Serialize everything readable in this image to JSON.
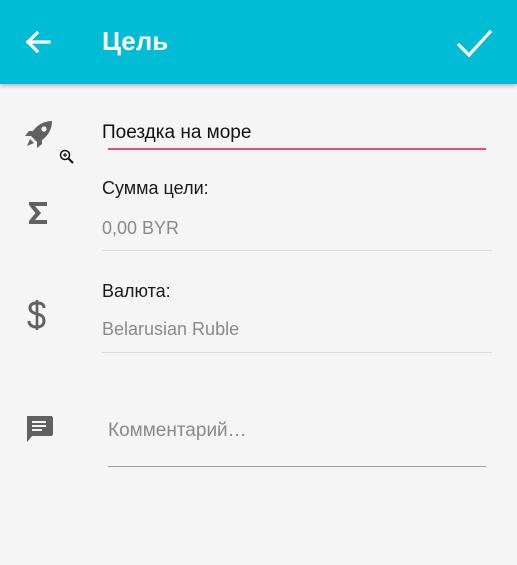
{
  "appbar": {
    "title": "Цель",
    "color": "#00bcd4",
    "back_icon": "arrow-back-icon",
    "confirm_icon": "check-icon"
  },
  "goal": {
    "name": "Поездка на море",
    "icon": "rocket-icon",
    "underline_color": "#e64a7d"
  },
  "amount": {
    "label": "Сумма цели:",
    "value": "0,00 BYR",
    "icon": "sigma-icon"
  },
  "currency": {
    "label": "Валюта:",
    "value": "Belarusian Ruble",
    "icon": "dollar-icon"
  },
  "comment": {
    "placeholder": "Комментарий…",
    "icon": "comment-icon"
  }
}
